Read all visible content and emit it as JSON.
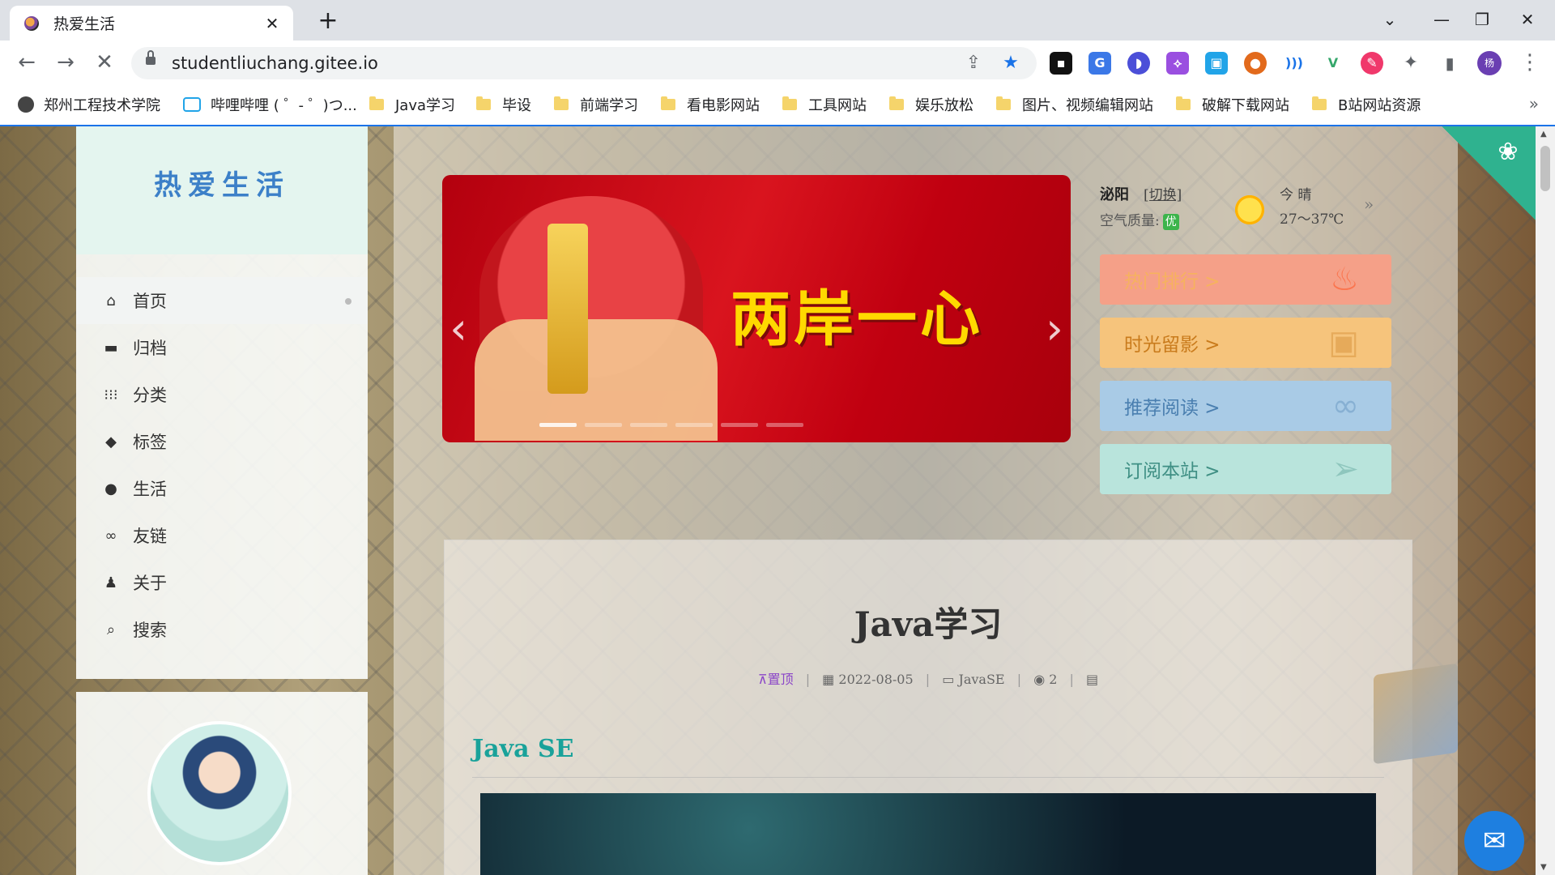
{
  "browser": {
    "tab_title": "热爱生活",
    "tab_close": "✕",
    "new_tab": "+",
    "url": "studentliuchang.gitee.io",
    "profile_initial": "杨",
    "bookmarks": [
      "郑州工程技术学院",
      "哔哩哔哩 ( ゜- ゜)つ...",
      "Java学习",
      "毕设",
      "前端学习",
      "看电影网站",
      "工具网站",
      "娱乐放松",
      "图片、视频编辑网站",
      "破解下载网站",
      "B站网站资源"
    ],
    "bookmarks_more": "»"
  },
  "site": {
    "title": "热爱生活",
    "menu": [
      {
        "label": "首页",
        "icon": "home-icon",
        "glyph": "⌂"
      },
      {
        "label": "归档",
        "icon": "archive-icon",
        "glyph": "▬"
      },
      {
        "label": "分类",
        "icon": "grid-icon",
        "glyph": "⁝⁝⁝"
      },
      {
        "label": "标签",
        "icon": "tags-icon",
        "glyph": "◆"
      },
      {
        "label": "生活",
        "icon": "apple-icon",
        "glyph": "●"
      },
      {
        "label": "友链",
        "icon": "link-icon",
        "glyph": "∞"
      },
      {
        "label": "关于",
        "icon": "user-icon",
        "glyph": "♟"
      },
      {
        "label": "搜索",
        "icon": "search-icon",
        "glyph": "⌕"
      }
    ]
  },
  "banner": {
    "text": "两岸一心",
    "prev": "‹",
    "next": "›"
  },
  "weather": {
    "city": "泌阳",
    "switch": "[切换]",
    "air_label": "空气质量:",
    "air_value": "优",
    "day": "今  晴",
    "temp": "27～37℃",
    "more": "»"
  },
  "quick_links": [
    {
      "label": "热门排行 >",
      "bg": "#f5a088",
      "fg": "#f6b25e"
    },
    {
      "label": "时光留影 >",
      "bg": "#f6c47c",
      "fg": "#c97b1c"
    },
    {
      "label": "推荐阅读 >",
      "bg": "#a9cbe6",
      "fg": "#4a7fb0"
    },
    {
      "label": "订阅本站 >",
      "bg": "#b9e4dc",
      "fg": "#3f8f84"
    }
  ],
  "post": {
    "title": "Java学习",
    "sticky": "置顶",
    "date": "2022-08-05",
    "category": "JavaSE",
    "views": "2",
    "heading": "Java SE"
  },
  "colors": {
    "accent": "#2fb28f",
    "link_blue": "#3c80c8",
    "heading_teal": "#19a29a"
  }
}
